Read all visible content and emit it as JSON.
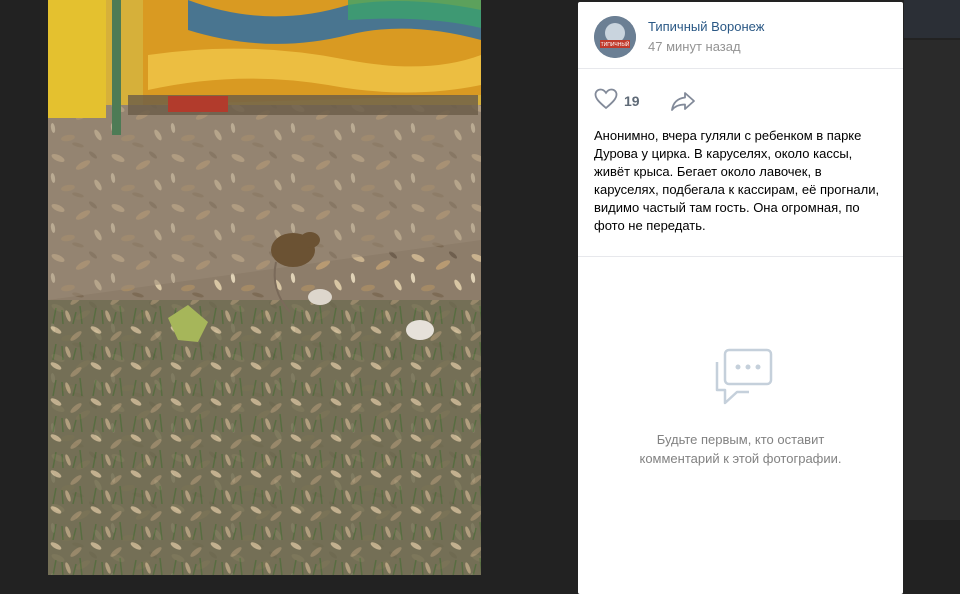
{
  "post": {
    "author_name": "Типичный Воронеж",
    "avatar_text": "ТИПИЧНЫЙ",
    "time": "47 минут назад",
    "likes": "19",
    "caption": "Анонимно, вчера гуляли с ребенком в парке Дурова у цирка. В каруселях, около кассы, живёт крыса. Бегает около лавочек, в каруселях, подбегала к кассирам, её прогнали, видимо частый там гость. Она огромная, по фото не передать."
  },
  "comments": {
    "empty_line1": "Будьте первым, кто оставит",
    "empty_line2": "комментарий к этой фотографии."
  },
  "icons": {
    "like": "heart-icon",
    "share": "share-arrow-icon",
    "comments": "speech-bubble-icon"
  },
  "colors": {
    "link": "#2a5885",
    "muted": "#939393",
    "icon": "#828a99",
    "panel": "#ffffff"
  }
}
